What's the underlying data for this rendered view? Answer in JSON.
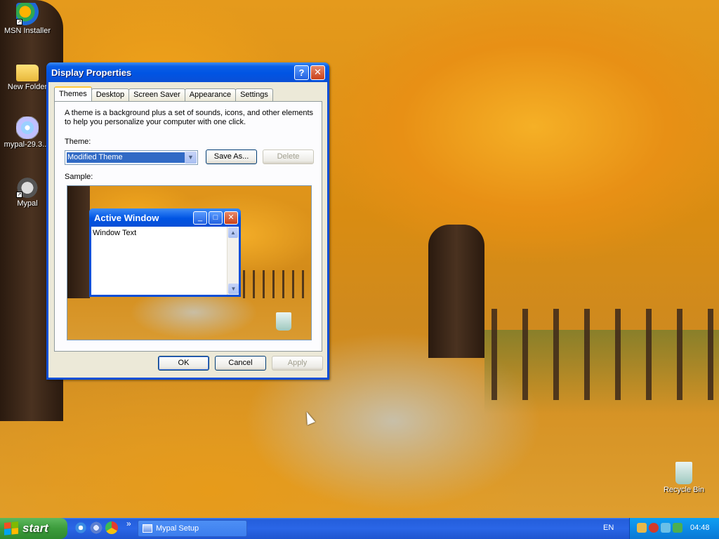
{
  "desktop": {
    "icons": [
      {
        "label": "MSN Installer",
        "icon": "msn-icon"
      },
      {
        "label": "New Folder",
        "icon": "folder-icon"
      },
      {
        "label": "mypal-29.3....",
        "icon": "disc-icon"
      },
      {
        "label": "Mypal",
        "icon": "mypal-icon"
      },
      {
        "label": "Recycle Bin",
        "icon": "recycle-bin-icon"
      }
    ]
  },
  "dialog": {
    "title": "Display Properties",
    "help_button": "?",
    "close_button": "✕",
    "tabs": [
      "Themes",
      "Desktop",
      "Screen Saver",
      "Appearance",
      "Settings"
    ],
    "active_tab": "Themes",
    "description": "A theme is a background plus a set of sounds, icons, and other elements to help you personalize your computer with one click.",
    "theme_label": "Theme:",
    "theme_value": "Modified Theme",
    "save_as_button": "Save As...",
    "delete_button": "Delete",
    "sample_label": "Sample:",
    "sample": {
      "window_title": "Active Window",
      "window_text": "Window Text",
      "minimize": "_",
      "maximize": "□",
      "close": "✕"
    },
    "ok_button": "OK",
    "cancel_button": "Cancel",
    "apply_button": "Apply"
  },
  "taskbar": {
    "start_label": "start",
    "quicklaunch_more": "»",
    "tasks": [
      {
        "label": "Mypal Setup"
      }
    ],
    "language": "EN",
    "clock": "04:48"
  },
  "colors": {
    "titlebar": "#0054e3",
    "taskbar": "#245edb",
    "start_button": "#3c9c3c",
    "dialog_face": "#ece9d8",
    "selection": "#316ac5"
  }
}
